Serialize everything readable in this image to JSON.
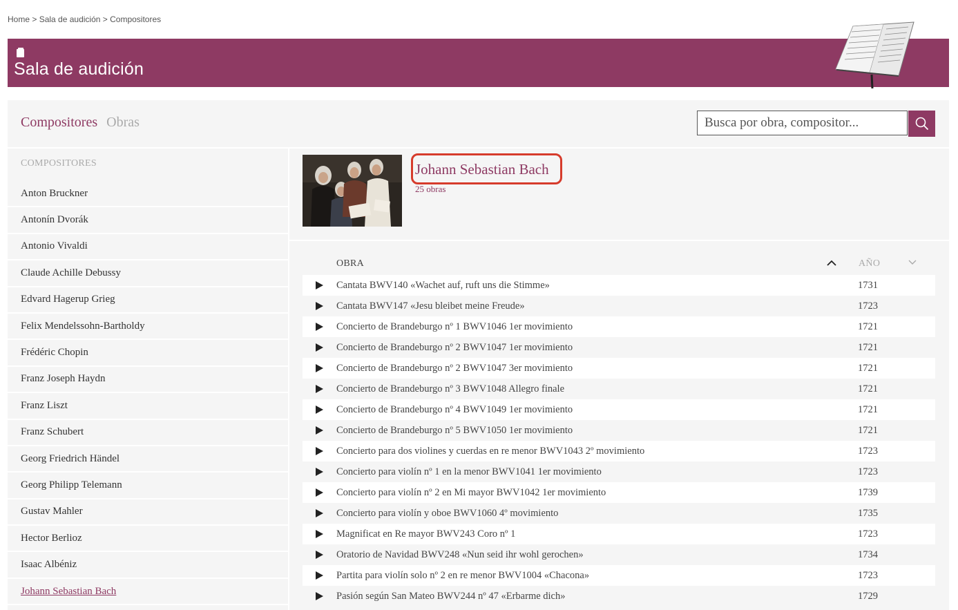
{
  "breadcrumb": {
    "home": "Home",
    "sep1": " > ",
    "section": "Sala de audición",
    "sep2": " > ",
    "current": "Compositores"
  },
  "banner": {
    "title": "Sala de audición",
    "icon": "document-icon",
    "color": "#8e3a63"
  },
  "tabs": {
    "composers": "Compositores",
    "works": "Obras"
  },
  "search": {
    "placeholder": "Busca por obra, compositor...",
    "icon": "search-icon"
  },
  "sidebar": {
    "heading": "COMPOSITORES",
    "items": [
      "Anton Bruckner",
      "Antonín Dvorák",
      "Antonio Vivaldi",
      "Claude Achille Debussy",
      "Edvard Hagerup Grieg",
      "Felix Mendelssohn-Bartholdy",
      "Frédéric Chopin",
      "Franz Joseph Haydn",
      "Franz Liszt",
      "Franz Schubert",
      "Georg Friedrich Händel",
      "Georg Philipp Telemann",
      "Gustav Mahler",
      "Hector Berlioz",
      "Isaac Albéniz",
      "Johann Sebastian Bach"
    ],
    "active": "Johann Sebastian Bach"
  },
  "composer": {
    "name": "Johann Sebastian Bach",
    "works_count": "25 obras"
  },
  "table": {
    "col_work": "OBRA",
    "col_year": "AÑO",
    "rows": [
      {
        "title": "Cantata BWV140 «Wachet auf, ruft uns die Stimme»",
        "year": "1731"
      },
      {
        "title": "Cantata BWV147 «Jesu bleibet meine Freude»",
        "year": "1723"
      },
      {
        "title": "Concierto de Brandeburgo nº 1 BWV1046 1er movimiento",
        "year": "1721"
      },
      {
        "title": "Concierto de Brandeburgo nº 2 BWV1047 1er movimiento",
        "year": "1721"
      },
      {
        "title": "Concierto de Brandeburgo nº 2 BWV1047 3er movimiento",
        "year": "1721"
      },
      {
        "title": "Concierto de Brandeburgo nº 3 BWV1048 Allegro finale",
        "year": "1721"
      },
      {
        "title": "Concierto de Brandeburgo nº 4 BWV1049 1er movimiento",
        "year": "1721"
      },
      {
        "title": "Concierto de Brandeburgo nº 5 BWV1050 1er movimiento",
        "year": "1721"
      },
      {
        "title": "Concierto para dos violines y cuerdas en re menor BWV1043 2º movimiento",
        "year": "1723"
      },
      {
        "title": "Concierto para violín nº 1 en la menor BWV1041 1er movimiento",
        "year": "1723"
      },
      {
        "title": "Concierto para violín nº 2 en Mi mayor BWV1042 1er movimiento",
        "year": "1739"
      },
      {
        "title": "Concierto para violín y oboe BWV1060 4º movimiento",
        "year": "1735"
      },
      {
        "title": "Magnificat en Re mayor BWV243 Coro nº 1",
        "year": "1723"
      },
      {
        "title": "Oratorio de Navidad BWV248 «Nun seid ihr wohl gerochen»",
        "year": "1734"
      },
      {
        "title": "Partita para violín solo nº 2 en re menor BWV1004 «Chacona»",
        "year": "1723"
      },
      {
        "title": "Pasión según San Mateo BWV244 nº 47 «Erbarme dich»",
        "year": "1729"
      }
    ]
  }
}
